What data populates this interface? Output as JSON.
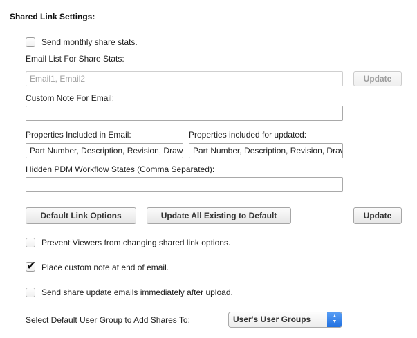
{
  "section": {
    "title": "Shared Link Settings:"
  },
  "monthly_stats": {
    "label": "Send monthly share stats.",
    "checked": false
  },
  "email_list": {
    "label": "Email List For Share Stats:",
    "placeholder": "Email1, Email2",
    "update_label": "Update"
  },
  "custom_note": {
    "label": "Custom Note For Email:",
    "value": ""
  },
  "properties_email": {
    "label": "Properties Included in Email:",
    "value": "Part Number, Description, Revision, Drawing"
  },
  "properties_updated": {
    "label": "Properties included for updated:",
    "value": "Part Number, Description, Revision, Drawing"
  },
  "hidden_states": {
    "label": "Hidden PDM Workflow States (Comma Separated):",
    "value": ""
  },
  "buttons": {
    "default_link_options": "Default Link Options",
    "update_all_existing": "Update All Existing to Default",
    "update": "Update"
  },
  "options": {
    "prevent_viewers": {
      "label": "Prevent Viewers from changing shared link options.",
      "checked": false
    },
    "custom_note_end": {
      "label": "Place custom note at end of email.",
      "checked": true
    },
    "send_update_emails": {
      "label": "Send share update emails immediately after upload.",
      "checked": false
    }
  },
  "user_group": {
    "label": "Select Default User Group to Add Shares To:",
    "selected": "User's User Groups"
  },
  "icons": {
    "checkmark": "checkmark-icon",
    "select_arrows": "up-down-arrows-icon"
  },
  "colors": {
    "select_accent": "#2a7ae6"
  }
}
